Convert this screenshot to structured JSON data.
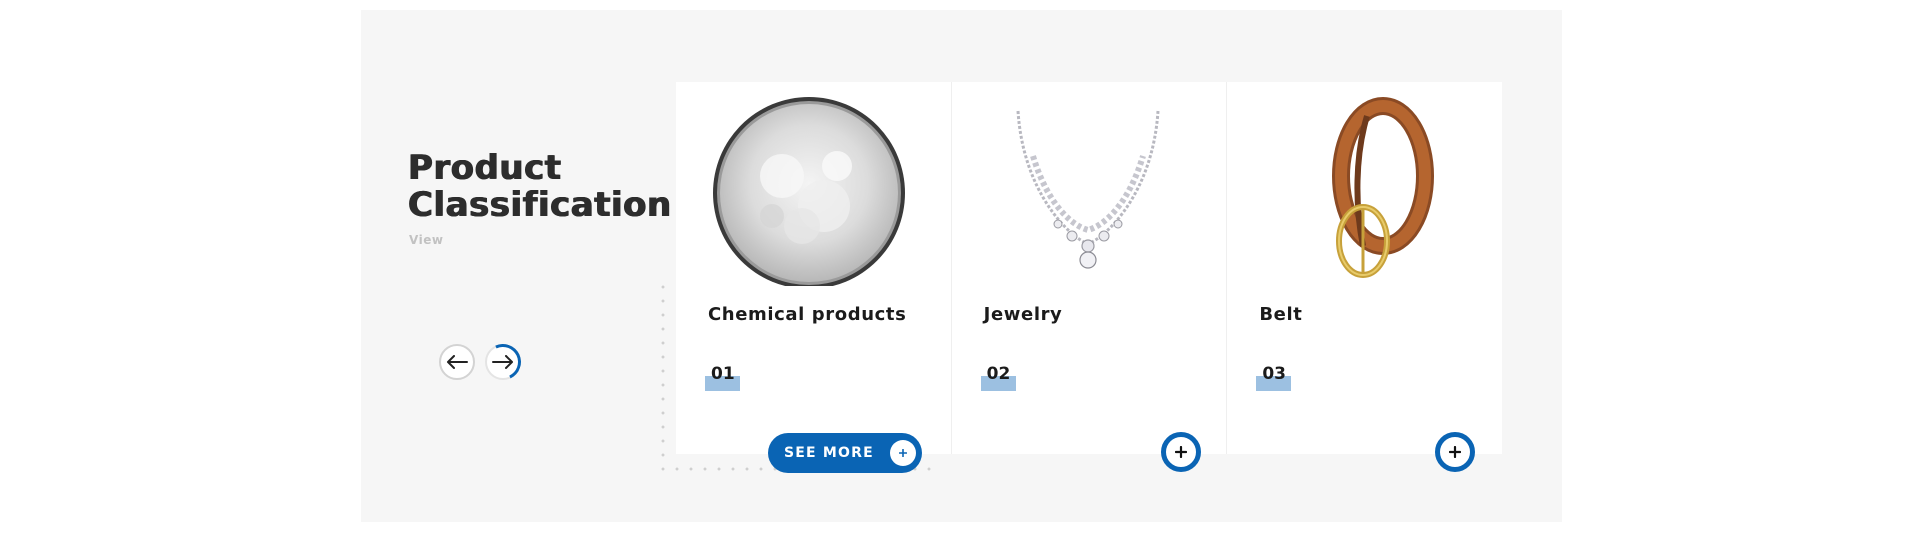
{
  "section": {
    "title_line1": "Product",
    "title_line2": "Classification",
    "view_label": "View"
  },
  "nav": {
    "prev_icon": "arrow-left-icon",
    "next_icon": "arrow-right-icon"
  },
  "cards": [
    {
      "title": "Chemical products",
      "number": "01",
      "image": "white-powder-dish"
    },
    {
      "title": "Jewelry",
      "number": "02",
      "image": "diamond-necklace"
    },
    {
      "title": "Belt",
      "number": "03",
      "image": "brown-leather-belt"
    }
  ],
  "see_more": {
    "label": "SEE MORE"
  },
  "colors": {
    "accent": "#0a64b4",
    "number_highlight": "#9cc0e1",
    "panel_bg": "#f6f6f6",
    "heading": "#2d2d2d"
  }
}
